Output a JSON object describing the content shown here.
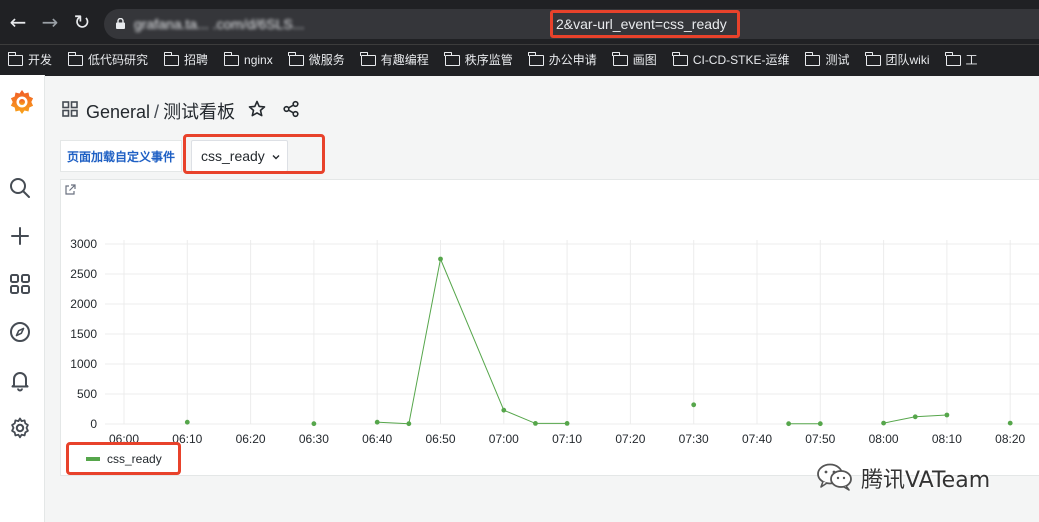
{
  "browser": {
    "url_host": "grafana.ta... .com/d/6SLS...",
    "url_param": "2&var-url_event=css_ready",
    "bookmarks": [
      "开发",
      "低代码研究",
      "招聘",
      "nginx",
      "微服务",
      "有趣编程",
      "秩序监管",
      "办公申请",
      "画图",
      "CI-CD-STKE-运维",
      "测试",
      "团队wiki",
      "工"
    ]
  },
  "header": {
    "folder": "General",
    "separator": "/",
    "title": "测试看板"
  },
  "variables": {
    "label": "页面加载自定义事件",
    "selected": "css_ready"
  },
  "chart_data": {
    "type": "line",
    "x": [
      "06:10",
      "06:30",
      "06:40",
      "06:45",
      "06:50",
      "07:00",
      "07:05",
      "07:10",
      "07:30",
      "07:45",
      "07:50",
      "08:00",
      "08:05",
      "08:10",
      "08:20"
    ],
    "series": [
      {
        "name": "css_ready",
        "values": [
          30,
          5,
          30,
          5,
          2750,
          230,
          10,
          10,
          320,
          5,
          5,
          15,
          120,
          150,
          15
        ],
        "segments": [
          [
            0
          ],
          [
            1
          ],
          [
            2,
            3,
            4,
            5,
            6,
            7
          ],
          [
            8
          ],
          [
            9,
            10
          ],
          [
            11,
            12,
            13
          ],
          [
            14
          ]
        ]
      }
    ],
    "x_ticks": [
      "06:00",
      "06:10",
      "06:20",
      "06:30",
      "06:40",
      "06:50",
      "07:00",
      "07:10",
      "07:20",
      "07:30",
      "07:40",
      "07:50",
      "08:00",
      "08:10",
      "08:20"
    ],
    "y_ticks": [
      "0",
      "500",
      "1000",
      "1500",
      "2000",
      "2500",
      "3000"
    ],
    "ylim": [
      0,
      3000
    ],
    "grid": true,
    "legend": "bottom-left",
    "color": "#56a64b"
  },
  "watermark": {
    "text": "腾讯VATeam"
  },
  "colors": {
    "highlight": "#e8422b",
    "series": "#56a64b",
    "link": "#1f60c4"
  }
}
